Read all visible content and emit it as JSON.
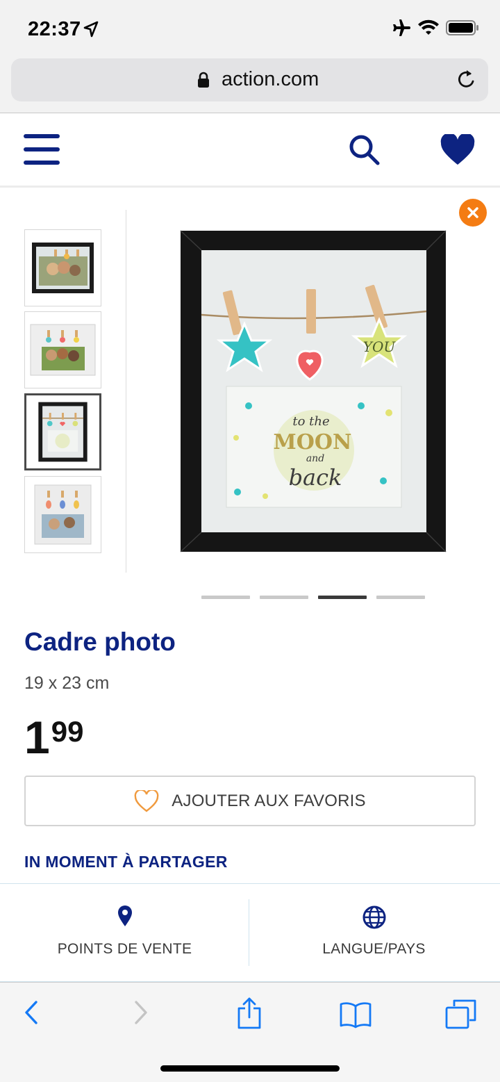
{
  "status_bar": {
    "time": "22:37"
  },
  "browser": {
    "url": "action.com"
  },
  "product": {
    "title": "Cadre photo",
    "size": "19 x 23 cm",
    "price_int": "1",
    "price_dec": "99",
    "image_text": {
      "line1": "to the",
      "line2": "MOON",
      "line3": "and",
      "line4": "back",
      "tag": "YOU"
    },
    "thumbnails_count": 4,
    "active_thumbnail": 3,
    "carousel_active_dot": 3
  },
  "actions": {
    "add_favorite_label": "AJOUTER AUX FAVORIS"
  },
  "section": {
    "heading": "IN MOMENT À PARTAGER"
  },
  "footer": {
    "stores_label": "POINTS DE VENTE",
    "language_label": "LANGUE/PAYS"
  },
  "colors": {
    "brand_blue": "#0d2381",
    "accent_orange": "#f47c13"
  }
}
